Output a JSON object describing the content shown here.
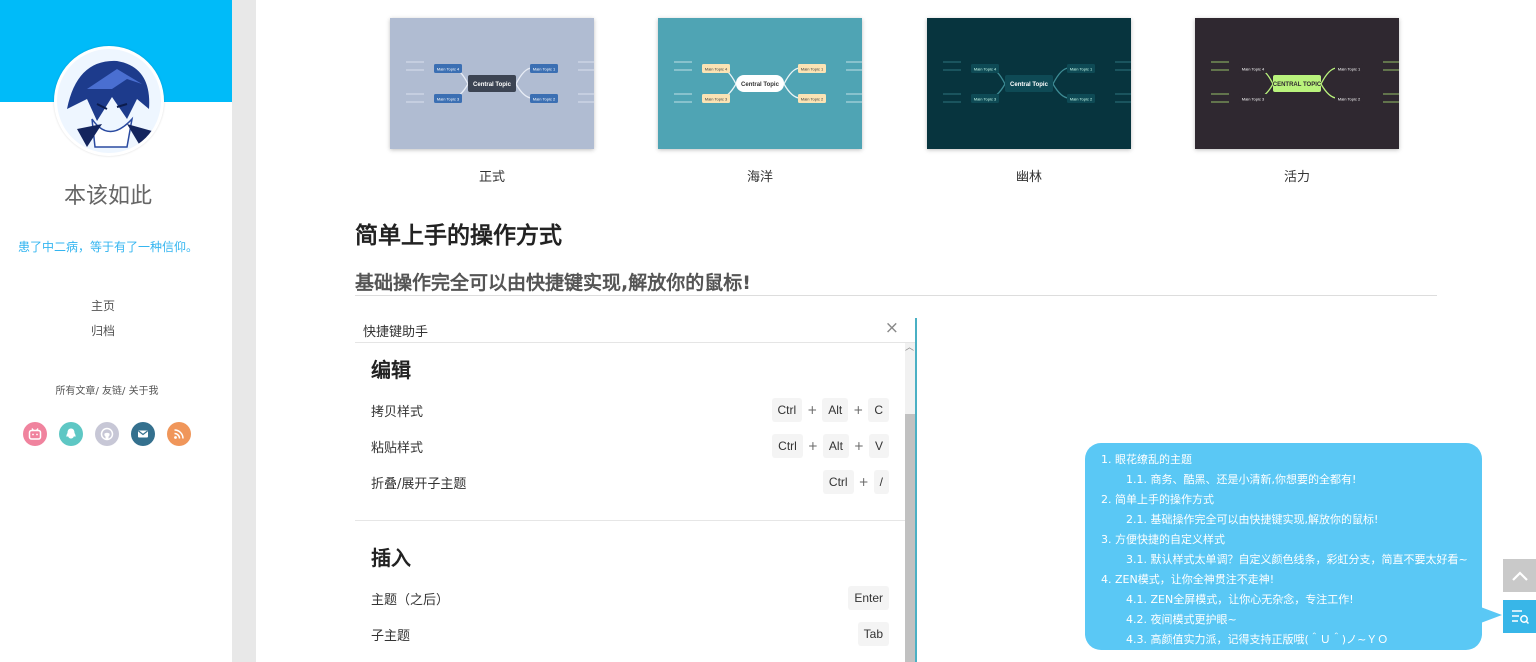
{
  "sidebar": {
    "title": "本该如此",
    "motto": "患了中二病，等于有了一种信仰。",
    "nav": [
      "主页",
      "归档"
    ],
    "links": {
      "all_posts": "所有文章",
      "sep1": "/",
      "friends": "友链",
      "sep2": "/",
      "about": "关于我"
    },
    "social": [
      {
        "name": "bilibili-icon",
        "color": "#f0839e"
      },
      {
        "name": "qq-icon",
        "color": "#5ec7c4"
      },
      {
        "name": "github-icon",
        "color": "#c7c7d6"
      },
      {
        "name": "email-icon",
        "color": "#34708e"
      },
      {
        "name": "rss-icon",
        "color": "#f0965a"
      }
    ]
  },
  "themes": [
    {
      "name": "正式",
      "bg": "#b0bcd2",
      "center": "Central Topic"
    },
    {
      "name": "海洋",
      "bg": "#4fa4b4",
      "center": "Central Topic"
    },
    {
      "name": "幽林",
      "bg": "#07343e",
      "center": "Central Topic"
    },
    {
      "name": "活力",
      "bg": "#2f2830",
      "center": "CENTRAL TOPIC"
    }
  ],
  "thumb_labels": {
    "main1": "Main Topic 1",
    "main2": "Main Topic 2",
    "main3": "Main Topic 3",
    "main4": "Main Topic 4"
  },
  "content": {
    "h2": "简单上手的操作方式",
    "h3": "基础操作完全可以由快捷键实现,解放你的鼠标!"
  },
  "panel": {
    "title": "快捷键助手",
    "close": "×",
    "groups": [
      {
        "title": "编辑",
        "rows": [
          {
            "label": "拷贝样式",
            "keys": [
              "Ctrl",
              "Alt",
              "C"
            ]
          },
          {
            "label": "粘贴样式",
            "keys": [
              "Ctrl",
              "Alt",
              "V"
            ]
          },
          {
            "label": "折叠/展开子主题",
            "keys": [
              "Ctrl",
              "/"
            ]
          }
        ]
      },
      {
        "title": "插入",
        "rows": [
          {
            "label": "主题（之后）",
            "keys": [
              "Enter"
            ]
          },
          {
            "label": "子主题",
            "keys": [
              "Tab"
            ]
          }
        ]
      }
    ]
  },
  "toc": [
    "1. 眼花缭乱的主题",
    "1.1. 商务、酷黑、还是小清新,你想要的全都有!",
    "2. 简单上手的操作方式",
    "2.1. 基础操作完全可以由快捷键实现,解放你的鼠标!",
    "3. 方便快捷的自定义样式",
    "3.1. 默认样式太单调？自定义颜色线条，彩虹分支，简直不要太好看~",
    "4. ZEN模式，让你全神贯注不走神!",
    "4.1. ZEN全屏模式，让你心无杂念，专注工作!",
    "4.2. 夜间模式更护眼~",
    "4.3. 高颜值实力派，记得支持正版哦(＾Ｕ＾)ノ~ＹＯ"
  ]
}
